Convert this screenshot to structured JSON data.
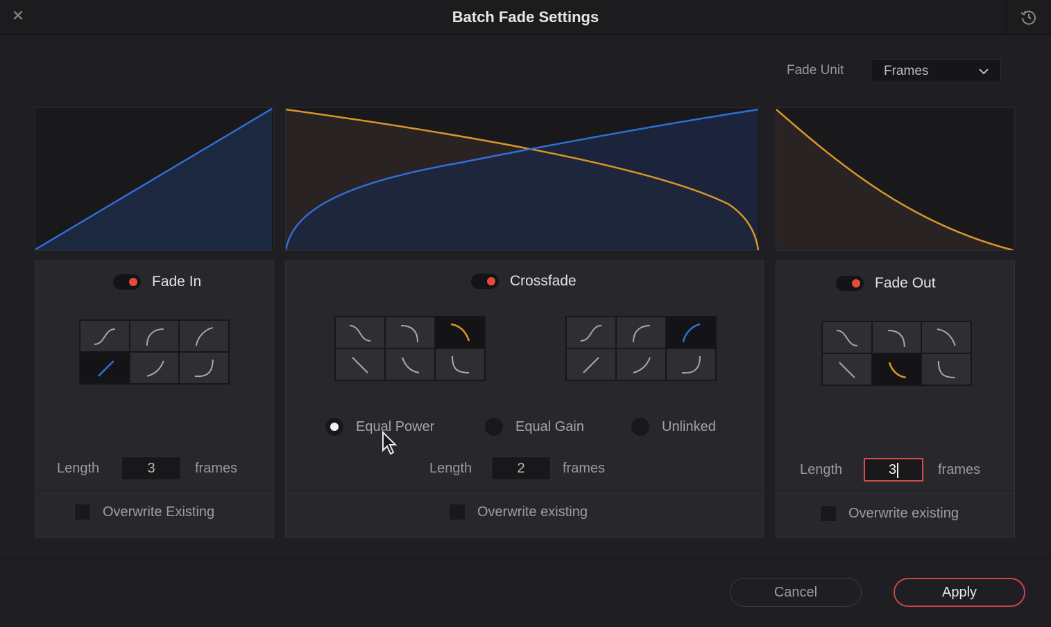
{
  "window": {
    "title": "Batch Fade Settings"
  },
  "header": {
    "fade_unit_label": "Fade Unit",
    "fade_unit_value": "Frames"
  },
  "fade_in": {
    "label": "Fade In",
    "enabled": true,
    "length_label": "Length",
    "length_value": "3",
    "units": "frames",
    "overwrite_label": "Overwrite Existing"
  },
  "crossfade": {
    "label": "Crossfade",
    "enabled": true,
    "modes": [
      "Equal Power",
      "Equal Gain",
      "Unlinked"
    ],
    "selected_mode": "Equal Power",
    "length_label": "Length",
    "length_value": "2",
    "units": "frames",
    "overwrite_label": "Overwrite existing"
  },
  "fade_out": {
    "label": "Fade Out",
    "enabled": true,
    "length_label": "Length",
    "length_value": "3",
    "units": "frames",
    "overwrite_label": "Overwrite existing"
  },
  "buttons": {
    "cancel": "Cancel",
    "apply": "Apply"
  },
  "icons": {
    "close": "close-icon",
    "reset": "reset-icon",
    "dropdown": "chevron-down-icon",
    "curve_presets": "curve-preset-icon",
    "cursor": "mouse-cursor-icon"
  },
  "colors": {
    "fade_in_curve": "#2f6fd6",
    "fade_out_curve": "#d9962a",
    "toggle_on": "#e84a3c",
    "apply_border": "#c94545"
  }
}
